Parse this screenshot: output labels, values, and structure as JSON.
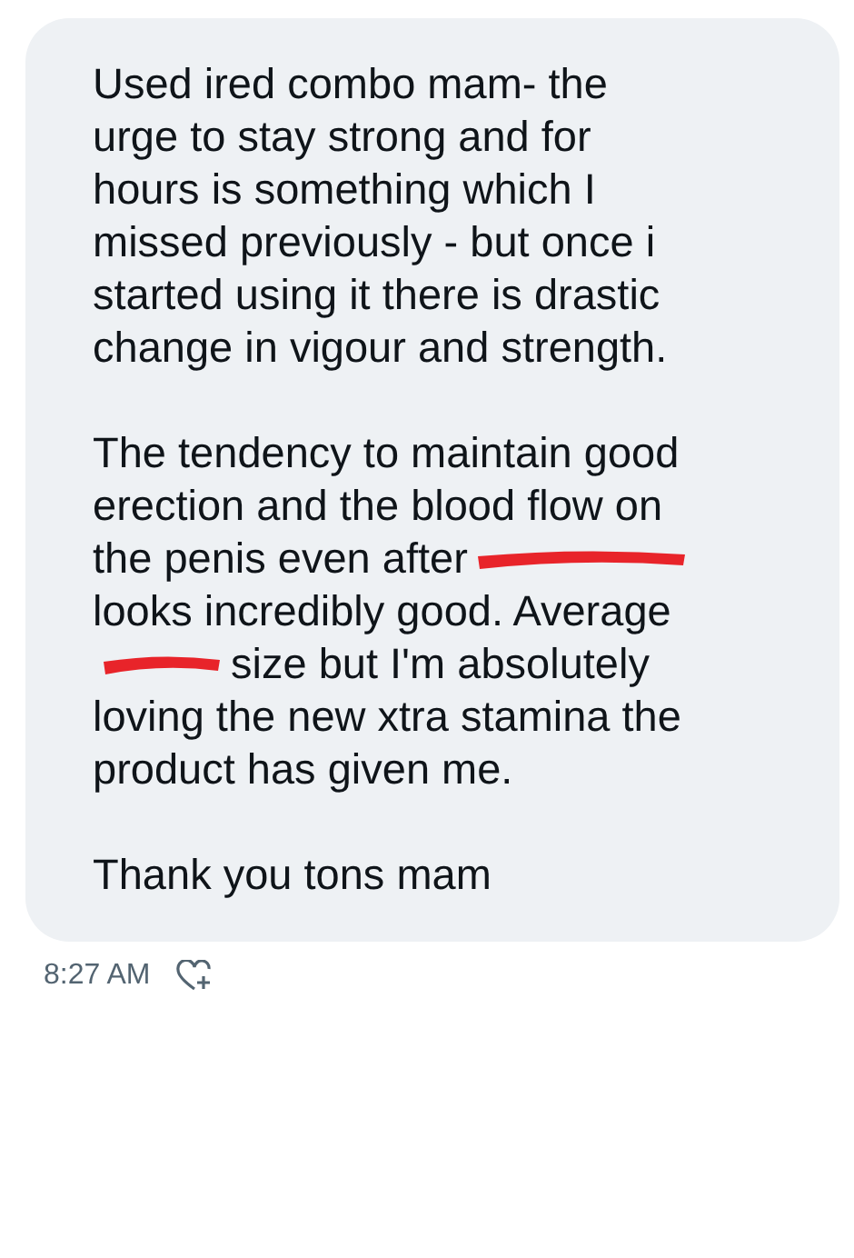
{
  "message": {
    "paragraphs": [
      [
        [
          {
            "kind": "text",
            "text": "Used ired combo mam- the"
          }
        ],
        [
          {
            "kind": "text",
            "text": "urge to stay strong and for"
          }
        ],
        [
          {
            "kind": "text",
            "text": "hours is something which I"
          }
        ],
        [
          {
            "kind": "text",
            "text": "missed previously - but once i"
          }
        ],
        [
          {
            "kind": "text",
            "text": "started using it there is drastic"
          }
        ],
        [
          {
            "kind": "text",
            "text": "change in vigour and strength."
          }
        ]
      ],
      [
        [
          {
            "kind": "text",
            "text": "The tendency to maintain good"
          }
        ],
        [
          {
            "kind": "text",
            "text": "erection and the blood flow on"
          }
        ],
        [
          {
            "kind": "text",
            "text": "the penis even after"
          },
          {
            "kind": "redaction_wide"
          }
        ],
        [
          {
            "kind": "text",
            "text": "looks incredibly good. Average"
          }
        ],
        [
          {
            "kind": "redaction_narrow"
          },
          {
            "kind": "text",
            "text": "size but I'm absolutely"
          }
        ],
        [
          {
            "kind": "text",
            "text": "loving the new xtra stamina the"
          }
        ],
        [
          {
            "kind": "text",
            "text": "product has given me."
          }
        ]
      ],
      [
        [
          {
            "kind": "text",
            "text": "Thank you tons mam"
          }
        ]
      ]
    ]
  },
  "meta": {
    "time": "8:27 AM"
  }
}
